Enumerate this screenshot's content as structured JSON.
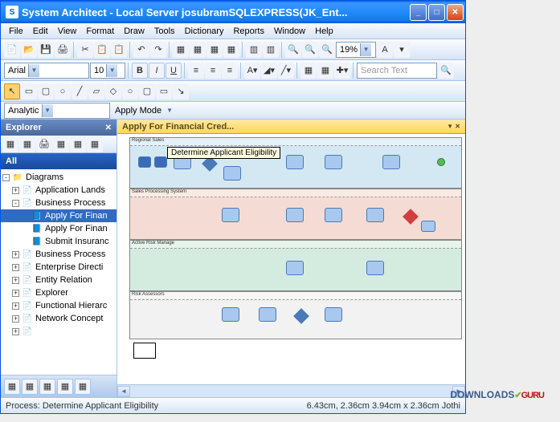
{
  "window": {
    "app_icon_letter": "S",
    "title": "System Architect - Local Server josubramSQLEXPRESS(JK_Ent...",
    "min": "_",
    "max": "□",
    "close": "✕"
  },
  "menu": {
    "file": "File",
    "edit": "Edit",
    "view": "View",
    "format": "Format",
    "draw": "Draw",
    "tools": "Tools",
    "dictionary": "Dictionary",
    "reports": "Reports",
    "window": "Window",
    "help": "Help"
  },
  "font": {
    "name": "Arial",
    "size": "10",
    "bold": "B",
    "italic": "I",
    "underline": "U"
  },
  "zoom": {
    "value": "19%"
  },
  "search": {
    "placeholder": "Search Text"
  },
  "mode": {
    "scheme": "Analytic",
    "apply": "Apply Mode"
  },
  "explorer": {
    "title": "Explorer",
    "all": "All",
    "root": "Diagrams",
    "items": [
      {
        "label": "Application Lands",
        "pm": "+",
        "indent": 1,
        "ic": "📄"
      },
      {
        "label": "Business Process",
        "pm": "-",
        "indent": 1,
        "ic": "📄"
      },
      {
        "label": "Apply For Finan",
        "pm": "",
        "indent": 2,
        "ic": "📘",
        "sel": true
      },
      {
        "label": "Apply For Finan",
        "pm": "",
        "indent": 2,
        "ic": "📘"
      },
      {
        "label": "Submit Insuranc",
        "pm": "",
        "indent": 2,
        "ic": "📘"
      },
      {
        "label": "Business Process",
        "pm": "+",
        "indent": 1,
        "ic": "📄"
      },
      {
        "label": "Enterprise Directi",
        "pm": "+",
        "indent": 1,
        "ic": "📄"
      },
      {
        "label": "Entity Relation",
        "pm": "+",
        "indent": 1,
        "ic": "📄"
      },
      {
        "label": "Explorer",
        "pm": "+",
        "indent": 1,
        "ic": "📄"
      },
      {
        "label": "Functional Hierarc",
        "pm": "+",
        "indent": 1,
        "ic": "📄"
      },
      {
        "label": "Network Concept",
        "pm": "+",
        "indent": 1,
        "ic": "📄"
      },
      {
        "label": "",
        "pm": "+",
        "indent": 1,
        "ic": "📄"
      }
    ]
  },
  "canvas": {
    "tab": "Apply For Financial Cred...",
    "tooltip": "Determine Applicant Eligibility",
    "lanes": [
      "Regional Sales",
      "Sales Processing System",
      "Active Risk Manage",
      "Risk Assessors"
    ]
  },
  "status": {
    "left": "Process: Determine Applicant Eligibility",
    "right": "6.43cm, 2.36cm   3.94cm x 2.36cm  Jothi"
  },
  "watermark": {
    "dl": "DOWNLOADS",
    "dot": "✔",
    "guru": "GURU"
  }
}
